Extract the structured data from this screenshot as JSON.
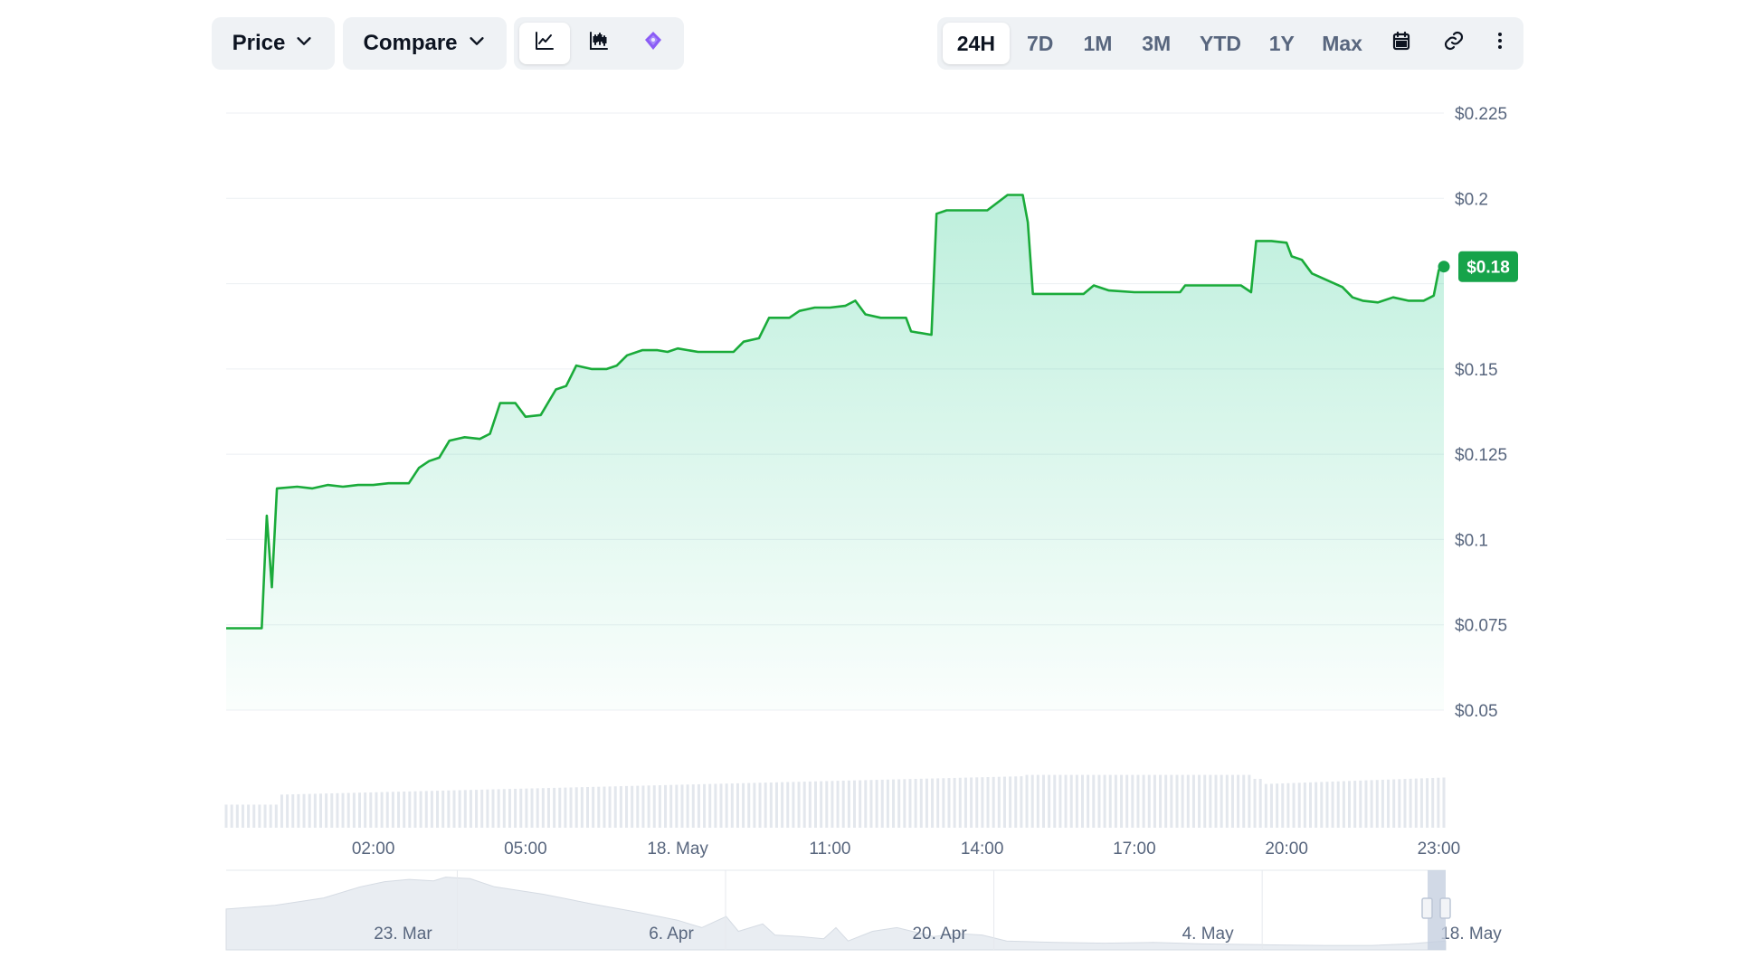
{
  "toolbar": {
    "price_label": "Price",
    "compare_label": "Compare",
    "chart_types": [
      {
        "icon": "line-chart-icon",
        "active": true
      },
      {
        "icon": "candlestick-chart-icon",
        "active": false
      },
      {
        "icon": "tradingview-icon",
        "active": false
      }
    ],
    "ranges": [
      {
        "label": "24H",
        "active": true
      },
      {
        "label": "7D",
        "active": false
      },
      {
        "label": "1M",
        "active": false
      },
      {
        "label": "3M",
        "active": false
      },
      {
        "label": "YTD",
        "active": false
      },
      {
        "label": "1Y",
        "active": false
      },
      {
        "label": "Max",
        "active": false
      }
    ],
    "tool_icons": [
      "calendar-icon",
      "link-icon",
      "more-vertical-icon"
    ]
  },
  "colors": {
    "line": "#16c784",
    "line_stroke": "#1aab3a",
    "price_tag": "#16a34a",
    "grid": "#eceff3",
    "volume": "#e3e7ed",
    "navigator": "#e9edf2",
    "navigator_handle": "#bcc6d6",
    "text_muted": "#58667e"
  },
  "chart_data": {
    "type": "area",
    "title": "",
    "xlabel": "",
    "ylabel": "",
    "current_price_label": "$0.18",
    "ylim": [
      0.05,
      0.225
    ],
    "y_ticks": [
      {
        "value": 0.225,
        "label": "$0.225"
      },
      {
        "value": 0.2,
        "label": "$0.2"
      },
      {
        "value": 0.15,
        "label": "$0.15"
      },
      {
        "value": 0.125,
        "label": "$0.125"
      },
      {
        "value": 0.1,
        "label": "$0.1"
      },
      {
        "value": 0.075,
        "label": "$0.075"
      },
      {
        "value": 0.05,
        "label": "$0.05"
      }
    ],
    "y_grid": [
      0.225,
      0.2,
      0.175,
      0.15,
      0.125,
      0.1,
      0.075,
      0.05
    ],
    "x_range_hours": [
      23.1,
      47.1
    ],
    "x_ticks": [
      {
        "hour": 26,
        "label": "02:00"
      },
      {
        "hour": 29,
        "label": "05:00"
      },
      {
        "hour": 32,
        "label": "18. May"
      },
      {
        "hour": 35,
        "label": "11:00"
      },
      {
        "hour": 38,
        "label": "14:00"
      },
      {
        "hour": 41,
        "label": "17:00"
      },
      {
        "hour": 44,
        "label": "20:00"
      },
      {
        "hour": 47,
        "label": "23:00"
      }
    ],
    "series": [
      {
        "points": [
          [
            23.1,
            0.074
          ],
          [
            23.8,
            0.074
          ],
          [
            23.9,
            0.107
          ],
          [
            24.0,
            0.086
          ],
          [
            24.1,
            0.115
          ],
          [
            24.5,
            0.1155
          ],
          [
            24.8,
            0.115
          ],
          [
            25.1,
            0.116
          ],
          [
            25.4,
            0.1155
          ],
          [
            25.7,
            0.116
          ],
          [
            26.0,
            0.116
          ],
          [
            26.3,
            0.1165
          ],
          [
            26.7,
            0.1165
          ],
          [
            26.9,
            0.121
          ],
          [
            27.1,
            0.123
          ],
          [
            27.3,
            0.124
          ],
          [
            27.5,
            0.129
          ],
          [
            27.8,
            0.13
          ],
          [
            28.1,
            0.1295
          ],
          [
            28.3,
            0.131
          ],
          [
            28.5,
            0.14
          ],
          [
            28.8,
            0.14
          ],
          [
            29.0,
            0.136
          ],
          [
            29.3,
            0.1365
          ],
          [
            29.6,
            0.144
          ],
          [
            29.8,
            0.145
          ],
          [
            30.0,
            0.151
          ],
          [
            30.3,
            0.15
          ],
          [
            30.6,
            0.15
          ],
          [
            30.8,
            0.151
          ],
          [
            31.0,
            0.154
          ],
          [
            31.3,
            0.1555
          ],
          [
            31.6,
            0.1555
          ],
          [
            31.8,
            0.155
          ],
          [
            32.0,
            0.156
          ],
          [
            32.2,
            0.1555
          ],
          [
            32.4,
            0.155
          ],
          [
            32.8,
            0.155
          ],
          [
            33.1,
            0.155
          ],
          [
            33.3,
            0.158
          ],
          [
            33.6,
            0.159
          ],
          [
            33.8,
            0.165
          ],
          [
            34.2,
            0.165
          ],
          [
            34.4,
            0.167
          ],
          [
            34.7,
            0.168
          ],
          [
            35.0,
            0.168
          ],
          [
            35.3,
            0.1685
          ],
          [
            35.5,
            0.17
          ],
          [
            35.7,
            0.166
          ],
          [
            36.0,
            0.165
          ],
          [
            36.5,
            0.165
          ],
          [
            36.6,
            0.161
          ],
          [
            37.0,
            0.16
          ],
          [
            37.1,
            0.1955
          ],
          [
            37.3,
            0.1965
          ],
          [
            37.7,
            0.1965
          ],
          [
            38.1,
            0.1965
          ],
          [
            38.5,
            0.201
          ],
          [
            38.8,
            0.201
          ],
          [
            38.9,
            0.193
          ],
          [
            39.0,
            0.172
          ],
          [
            39.6,
            0.172
          ],
          [
            40.0,
            0.172
          ],
          [
            40.2,
            0.1745
          ],
          [
            40.5,
            0.173
          ],
          [
            41.0,
            0.1725
          ],
          [
            41.5,
            0.1725
          ],
          [
            41.9,
            0.1725
          ],
          [
            42.0,
            0.1745
          ],
          [
            43.1,
            0.1745
          ],
          [
            43.3,
            0.1725
          ],
          [
            43.4,
            0.1875
          ],
          [
            43.7,
            0.1875
          ],
          [
            44.0,
            0.187
          ],
          [
            44.1,
            0.183
          ],
          [
            44.3,
            0.182
          ],
          [
            44.5,
            0.178
          ],
          [
            44.8,
            0.176
          ],
          [
            45.1,
            0.174
          ],
          [
            45.3,
            0.171
          ],
          [
            45.5,
            0.17
          ],
          [
            45.8,
            0.1695
          ],
          [
            46.1,
            0.171
          ],
          [
            46.4,
            0.17
          ],
          [
            46.7,
            0.17
          ],
          [
            46.9,
            0.1715
          ],
          [
            47.0,
            0.179
          ],
          [
            47.1,
            0.18
          ]
        ]
      }
    ],
    "navigator": {
      "labels": [
        {
          "pos": 0.145,
          "label": "23. Mar"
        },
        {
          "pos": 0.365,
          "label": "6. Apr"
        },
        {
          "pos": 0.585,
          "label": "20. Apr"
        },
        {
          "pos": 0.805,
          "label": "4. May"
        },
        {
          "pos": 1.0,
          "label": "18. May"
        }
      ]
    }
  }
}
